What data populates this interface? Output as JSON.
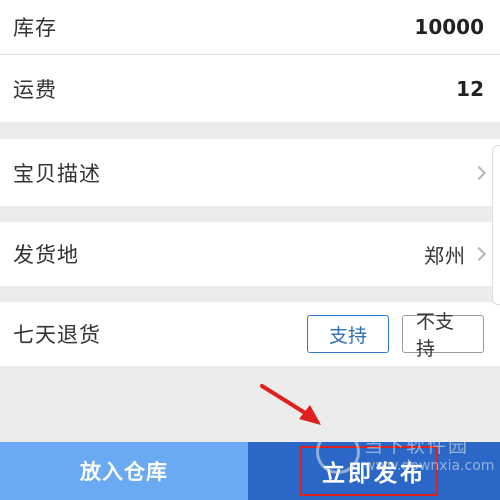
{
  "rows": {
    "stock": {
      "label": "库存",
      "value": "10000"
    },
    "shipping": {
      "label": "运费",
      "value": "12"
    },
    "description": {
      "label": "宝贝描述"
    },
    "ship_from": {
      "label": "发货地",
      "value": "郑州"
    },
    "returns": {
      "label": "七天退货",
      "options": [
        "支持",
        "不支持"
      ],
      "selected": "支持"
    }
  },
  "footer": {
    "store_label": "放入仓库",
    "publish_label": "立即发布"
  },
  "watermark": {
    "main": "当下软件园",
    "sub": "www.downxia.com"
  },
  "colors": {
    "accent": "#2a67c6",
    "secondary_button": "#6aaaf2",
    "highlight": "#e0201e"
  }
}
